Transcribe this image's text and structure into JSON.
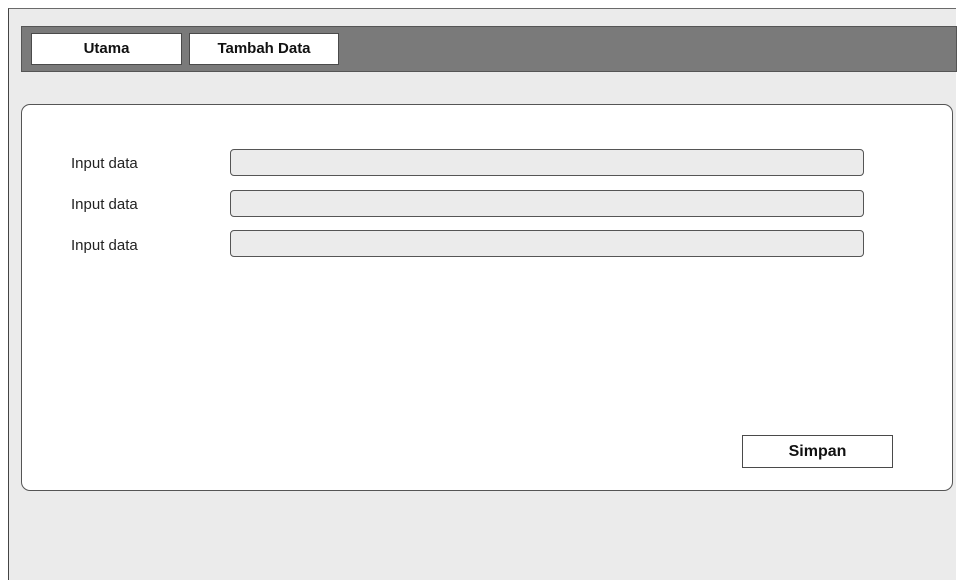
{
  "tabs": [
    {
      "label": "Utama"
    },
    {
      "label": "Tambah Data"
    }
  ],
  "form": {
    "fields": [
      {
        "label": "Input data",
        "value": ""
      },
      {
        "label": "Input data",
        "value": ""
      },
      {
        "label": "Input data",
        "value": ""
      }
    ],
    "submit_label": "Simpan"
  },
  "colors": {
    "tabbar": "#7a7a7a",
    "background": "#ebebeb",
    "panel": "#ffffff",
    "field_fill": "#ebebeb",
    "border": "#555555"
  }
}
